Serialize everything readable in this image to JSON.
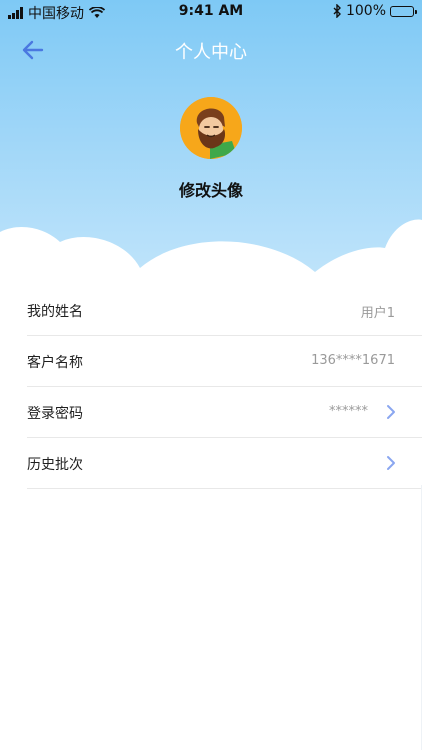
{
  "status_bar": {
    "carrier": "中国移动",
    "time": "9:41 AM",
    "battery": "100%"
  },
  "nav": {
    "title": "个人中心"
  },
  "profile": {
    "avatar_label": "修改头像"
  },
  "rows": [
    {
      "label": "我的姓名",
      "value": "用户1"
    },
    {
      "label": "客户名称",
      "value": "136****1671"
    },
    {
      "label": "登录密码",
      "value": "******"
    },
    {
      "label": "历史批次",
      "value": ""
    }
  ],
  "colors": {
    "header_top": "#7ec9f5",
    "accent": "#4a78e0",
    "avatar_bg": "#f7a71a"
  }
}
